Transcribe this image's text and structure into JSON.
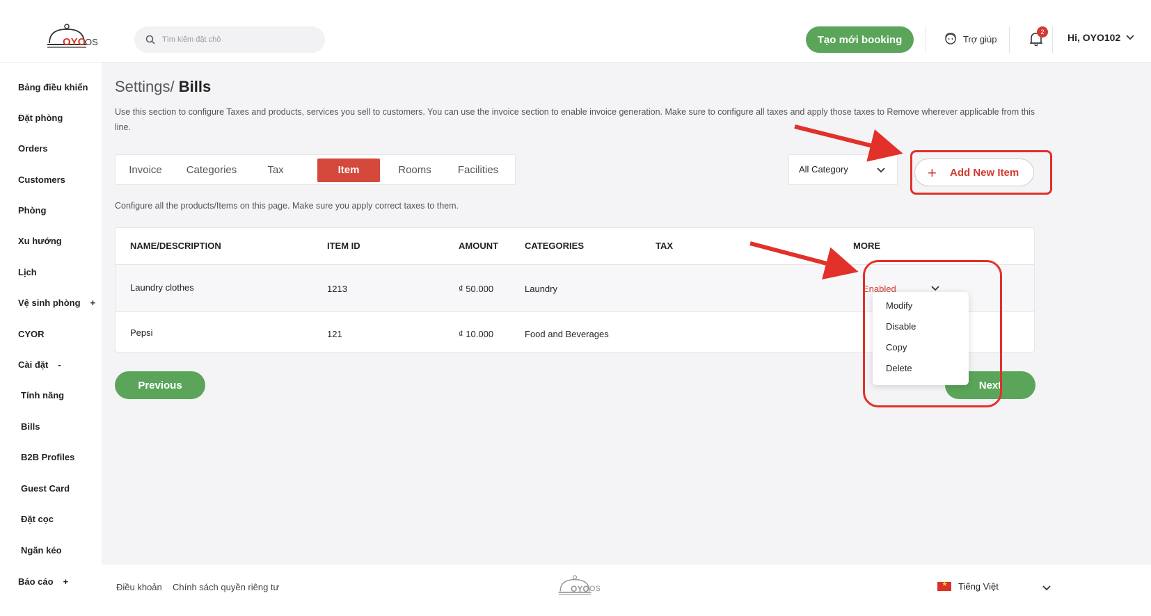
{
  "header": {
    "logo_brand": "OYO",
    "logo_suffix": "OS",
    "search_placeholder": "Tìm kiếm đặt chỗ",
    "new_booking": "Tạo mới booking",
    "help": "Trợ giúp",
    "notification_count": "2",
    "user": "Hi, OYO102"
  },
  "sidebar": {
    "items": [
      {
        "label": "Bảng điều khiển"
      },
      {
        "label": "Đặt phòng"
      },
      {
        "label": "Orders"
      },
      {
        "label": "Customers"
      },
      {
        "label": "Phòng"
      },
      {
        "label": "Xu hướng"
      },
      {
        "label": "Lịch"
      },
      {
        "label": "Vệ sinh phòng",
        "toggle": "+"
      },
      {
        "label": "CYOR"
      },
      {
        "label": "Cài đặt",
        "toggle": "-"
      },
      {
        "label": "Tính năng"
      },
      {
        "label": "Bills"
      },
      {
        "label": "B2B Profiles"
      },
      {
        "label": "Guest Card"
      },
      {
        "label": "Đặt cọc"
      },
      {
        "label": "Ngăn kéo"
      },
      {
        "label": "Báo cáo",
        "toggle": "+"
      }
    ]
  },
  "page": {
    "breadcrumb_parent": "Settings/",
    "breadcrumb_current": "Bills",
    "description": "Use this section to configure Taxes and products, services you sell to customers. You can use the invoice section to enable invoice generation. Make sure to configure all taxes and apply those taxes to Remove wherever applicable from this line.",
    "tabs": [
      "Invoice",
      "Categories",
      "Tax",
      "Item",
      "Rooms",
      "Facilities"
    ],
    "active_tab": "Item",
    "category_filter": "All Category",
    "add_button": "Add New Item",
    "configure_text": "Configure all the products/Items on this page. Make sure you apply correct taxes to them."
  },
  "table": {
    "headers": [
      "NAME/DESCRIPTION",
      "ITEM ID",
      "AMOUNT",
      "CATEGORIES",
      "TAX",
      "MORE"
    ],
    "rows": [
      {
        "name": "Laundry clothes",
        "id": "1213",
        "amount": "₫ 50.000",
        "category": "Laundry",
        "status": "Enabled"
      },
      {
        "name": "Pepsi",
        "id": "121",
        "amount": "₫ 10.000",
        "category": "Food and Beverages",
        "status": ""
      }
    ]
  },
  "dropdown_menu": [
    "Modify",
    "Disable",
    "Copy",
    "Delete"
  ],
  "pagination": {
    "previous": "Previous",
    "next": "Next"
  },
  "footer": {
    "terms": "Điều khoản",
    "privacy": "Chính sách quyền riêng tư",
    "language": "Tiếng Việt"
  },
  "colors": {
    "brand_green": "#5aa55a",
    "brand_red": "#d23b2f",
    "annotation_red": "#e2302a"
  }
}
